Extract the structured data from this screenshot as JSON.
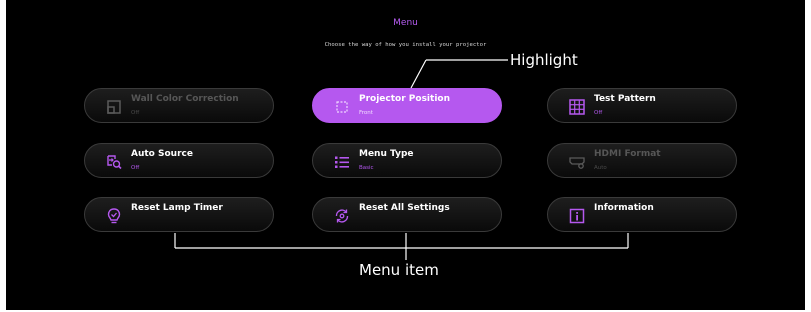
{
  "header": {
    "title": "Menu",
    "subtitle": "Choose the way of how you install your projector"
  },
  "menu_items": [
    {
      "label": "Wall Color Correction",
      "value": "Off",
      "icon": "wall-color-icon",
      "state": "disabled"
    },
    {
      "label": "Projector Position",
      "value": "Front",
      "icon": "projector-position-icon",
      "state": "highlighted"
    },
    {
      "label": "Test Pattern",
      "value": "Off",
      "icon": "grid-icon",
      "state": "normal"
    },
    {
      "label": "Auto Source",
      "value": "Off",
      "icon": "source-search-icon",
      "state": "normal"
    },
    {
      "label": "Menu Type",
      "value": "Basic",
      "icon": "list-icon",
      "state": "normal"
    },
    {
      "label": "HDMI Format",
      "value": "Auto",
      "icon": "hdmi-settings-icon",
      "state": "disabled"
    },
    {
      "label": "Reset Lamp Timer",
      "value": "",
      "icon": "lamp-icon",
      "state": "normal"
    },
    {
      "label": "Reset All Settings",
      "value": "",
      "icon": "reset-settings-icon",
      "state": "normal"
    },
    {
      "label": "Information",
      "value": "",
      "icon": "info-icon",
      "state": "normal"
    }
  ],
  "callouts": {
    "highlight": "Highlight",
    "menu_item": "Menu item"
  },
  "colors": {
    "accent": "#b558ef",
    "background": "#000000",
    "disabled_text": "#565656"
  }
}
